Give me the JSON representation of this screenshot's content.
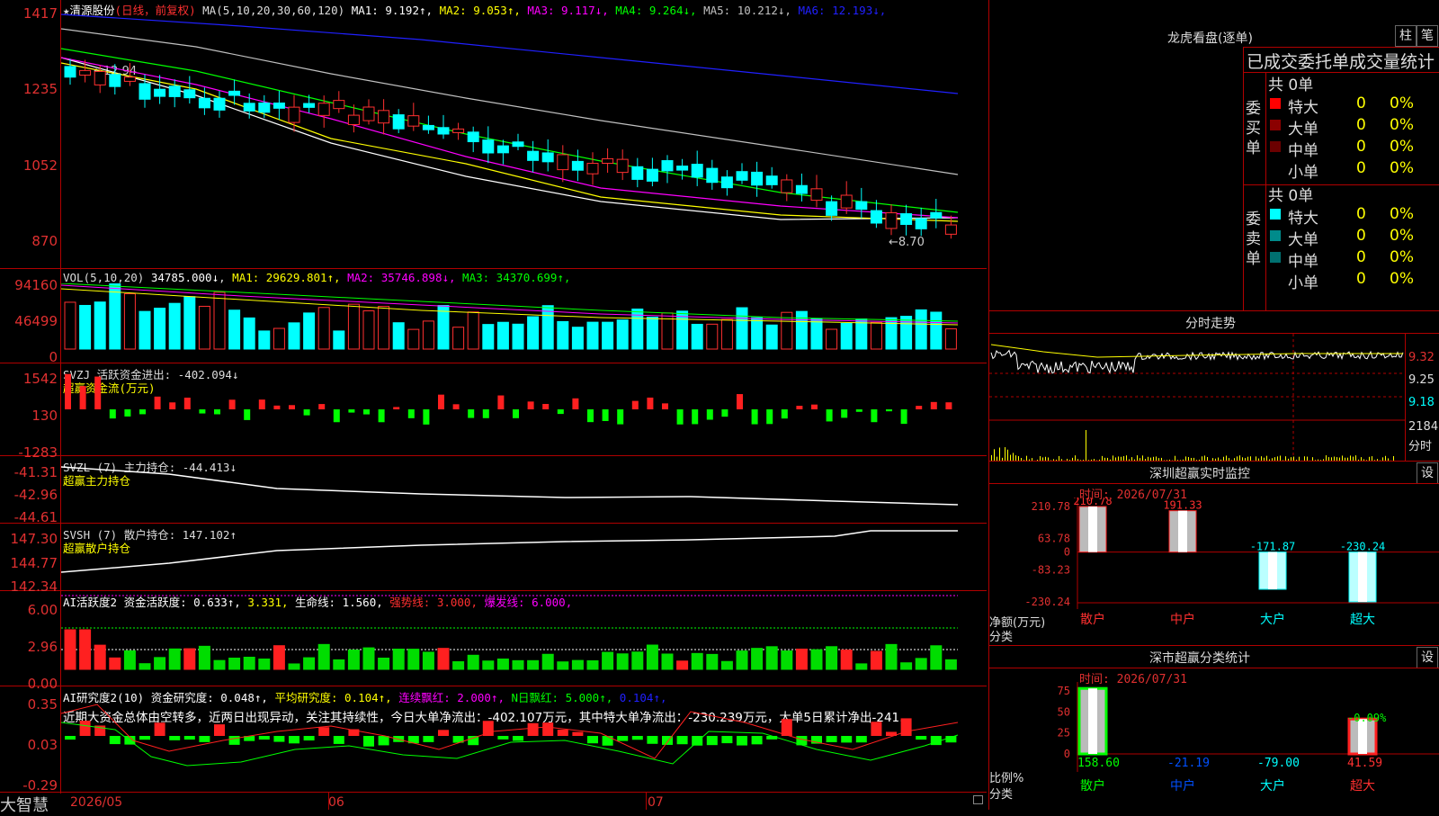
{
  "app": {
    "brand": "大智慧"
  },
  "kline": {
    "star": "★",
    "stock_name": "清源股份",
    "mode": "(日线，前复权)",
    "ma_label": "MA(5,10,20,30,60,120)",
    "ma_items": [
      {
        "text": "MA1: 9.192↑",
        "color": "#ffffff"
      },
      {
        "text": "MA2: 9.053↑",
        "color": "#ffff00"
      },
      {
        "text": "MA3: 9.117↓",
        "color": "#ff00ff"
      },
      {
        "text": "MA4: 9.264↓",
        "color": "#00ff00"
      },
      {
        "text": "MA5: 10.212↓",
        "color": "#c0c0c0"
      },
      {
        "text": "MA6: 12.193↓",
        "color": "#2020ff"
      }
    ],
    "y_ticks": [
      "1417",
      "1235",
      "1052",
      "870"
    ],
    "high_marker": "←12.94",
    "low_marker": "←8.70",
    "ma_colors": [
      "#ffffff",
      "#ffff00",
      "#ff00ff",
      "#00ff00",
      "#c0c0c0",
      "#2020ff"
    ]
  },
  "vol": {
    "label": "VOL(5,10,20)",
    "value": "34785.000↓",
    "items": [
      {
        "text": "MA1: 29629.801↑",
        "color": "#ffff00"
      },
      {
        "text": "MA2: 35746.898↓",
        "color": "#ff00ff"
      },
      {
        "text": "MA3: 34370.699↑",
        "color": "#00ff00"
      }
    ],
    "y_ticks": [
      "94160",
      "46499",
      "0"
    ]
  },
  "svzj": {
    "label": "SVZJ  活跃资金进出: -402.094↓",
    "sub": "超赢资金流(万元)",
    "y_ticks": [
      "1542",
      "130",
      "-1283"
    ]
  },
  "svzl": {
    "label": "SVZL (7) 主力持仓: -44.413↓",
    "sub": "超赢主力持仓",
    "y_ticks": [
      "-41.31",
      "-42.96",
      "-44.61"
    ]
  },
  "svsh": {
    "label": "SVSH (7) 散户持仓: 147.102↑",
    "sub": "超赢散户持仓",
    "y_ticks": [
      "147.30",
      "144.77",
      "142.34"
    ]
  },
  "ai_active": {
    "items": [
      {
        "text": "AI活跃度2 资金活跃度: 0.633↑",
        "color": "#ffffff"
      },
      {
        "text": " 3.331",
        "color": "#ffff00"
      },
      {
        "text": " 生命线: 1.560",
        "color": "#ffffff"
      },
      {
        "text": " 强势线: 3.000",
        "color": "#ff3030"
      },
      {
        "text": " 爆发线: 6.000",
        "color": "#ff00ff"
      }
    ],
    "y_ticks": [
      "6.00",
      "2.96",
      "0.00"
    ]
  },
  "ai_research": {
    "items": [
      {
        "text": "AI研究度2(10) 资金研究度: 0.048↑",
        "color": "#ffffff"
      },
      {
        "text": " 平均研究度: 0.104↑",
        "color": "#ffff00"
      },
      {
        "text": " 连续飘红: 2.000↑",
        "color": "#ff00ff"
      },
      {
        "text": " N日飘红: 5.000↑",
        "color": "#00ff00"
      },
      {
        "text": " 0.104↑",
        "color": "#2020ff"
      }
    ],
    "comment": "近期大资金总体由空转多，近两日出现异动，关注其持续性，今日大单净流出：-402.107万元，其中特大单净流出：-230.239万元，大单5日累计净出-241.",
    "y_ticks": [
      "0.35",
      "0.03",
      "-0.29"
    ]
  },
  "x_axis": {
    "labels": [
      "2026/05",
      "06",
      "07"
    ]
  },
  "longhu": {
    "title": "龙虎看盘(逐单)",
    "btn1": "柱",
    "btn2": "笔",
    "heading": "已成交委托单成交量统计",
    "buy": {
      "side": [
        "委",
        "买",
        "单"
      ],
      "total": "共 0单",
      "rows": [
        {
          "label": "特大",
          "count": "0",
          "pct": "0%",
          "color": "#ff0000"
        },
        {
          "label": "大单",
          "count": "0",
          "pct": "0%",
          "color": "#8b0000"
        },
        {
          "label": "中单",
          "count": "0",
          "pct": "0%",
          "color": "#6b0000"
        },
        {
          "label": "小单",
          "count": "0",
          "pct": "0%",
          "color": "#000000"
        }
      ]
    },
    "sell": {
      "side": [
        "委",
        "卖",
        "单"
      ],
      "total": "共 0单",
      "rows": [
        {
          "label": "特大",
          "count": "0",
          "pct": "0%",
          "color": "#00ffff"
        },
        {
          "label": "大单",
          "count": "0",
          "pct": "0%",
          "color": "#008b8b"
        },
        {
          "label": "中单",
          "count": "0",
          "pct": "0%",
          "color": "#007070"
        },
        {
          "label": "小单",
          "count": "0",
          "pct": "0%",
          "color": "#000000"
        }
      ]
    }
  },
  "intraday": {
    "title": "分时走势",
    "y_ticks": [
      "9.32",
      "9.25",
      "9.18"
    ],
    "vol_max": "2184",
    "vol_label": "分时"
  },
  "monitor": {
    "title": "深圳超赢实时监控",
    "btn": "设",
    "time": "时间: 2026/07/31",
    "y_ticks": [
      "210.78",
      "63.78",
      "0",
      "-83.23",
      "-230.24"
    ],
    "ylabel": "净额(万元)",
    "xlabel": "分类",
    "categories": [
      "散户",
      "中户",
      "大户",
      "超大"
    ],
    "values": [
      "210.78",
      "191.33",
      "-171.87",
      "-230.24"
    ]
  },
  "classify": {
    "title": "深市超赢分类统计",
    "btn": "设",
    "time": "时间: 2026/07/31",
    "y_ticks": [
      "75",
      "50",
      "25",
      "0"
    ],
    "ylabel": "比例%",
    "xlabel": "分类",
    "categories": [
      "散户",
      "中户",
      "大户",
      "超大"
    ],
    "values": [
      "158.60",
      "-21.19",
      "-79.00",
      "41.59"
    ],
    "pct_label": "-0.09%"
  },
  "chart_data": [
    {
      "type": "bar",
      "title": "深圳超赢实时监控",
      "ylabel": "净额(万元)",
      "categories": [
        "散户",
        "中户",
        "大户",
        "超大"
      ],
      "values": [
        210.78,
        191.33,
        -171.87,
        -230.24
      ],
      "ylim": [
        -230.24,
        210.78
      ]
    },
    {
      "type": "bar",
      "title": "深市超赢分类统计",
      "ylabel": "比例%",
      "categories": [
        "散户",
        "中户",
        "大户",
        "超大"
      ],
      "values": [
        158.6,
        -21.19,
        -79.0,
        41.59
      ],
      "ylim": [
        0,
        75
      ]
    }
  ]
}
